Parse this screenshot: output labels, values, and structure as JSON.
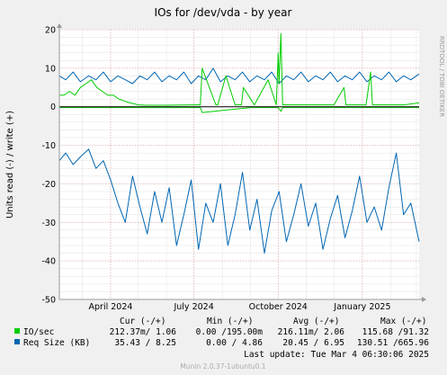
{
  "chart_data": {
    "type": "line",
    "title": "IOs for /dev/vda - by year",
    "ylabel": "Units read (-) / write (+)",
    "side_label": "RRDTOOL / TOBI OETIKER",
    "footer": "Munin 2.0.37-1ubuntu0.1",
    "last_update": "Last update: Tue Mar  4 06:30:06 2025",
    "ylim": [
      -50,
      20
    ],
    "y_ticks": [
      20,
      10,
      0,
      -10,
      -20,
      -30,
      -40,
      -50
    ],
    "x_range": [
      "2024-02-05",
      "2025-03-04"
    ],
    "x_ticks": [
      {
        "date": "2024-04-01",
        "label": "April 2024"
      },
      {
        "date": "2024-07-01",
        "label": "July 2024"
      },
      {
        "date": "2024-10-01",
        "label": "October 2024"
      },
      {
        "date": "2025-01-01",
        "label": "January 2025"
      }
    ],
    "grid": true,
    "legend_headers": [
      "Cur (-/+)",
      "Min (-/+)",
      "Avg (-/+)",
      "Max (-/+)"
    ],
    "series": [
      {
        "name": "IO/sec",
        "color": "#00cc00",
        "cur": "212.37m/ 1.06",
        "min": "0.00 /195.00m",
        "avg": "216.11m/ 2.06",
        "max": "115.68 /91.32",
        "write_x": [
          "2024-02-05",
          "2024-02-10",
          "2024-02-16",
          "2024-02-22",
          "2024-02-28",
          "2024-03-05",
          "2024-03-11",
          "2024-03-17",
          "2024-03-23",
          "2024-03-29",
          "2024-04-04",
          "2024-04-10",
          "2024-04-16",
          "2024-04-22",
          "2024-04-28",
          "2024-05-01",
          "2024-05-10",
          "2024-06-01",
          "2024-07-01",
          "2024-07-08",
          "2024-07-10",
          "2024-07-25",
          "2024-07-27",
          "2024-08-05",
          "2024-08-15",
          "2024-08-22",
          "2024-08-24",
          "2024-09-05",
          "2024-09-20",
          "2024-09-29",
          "2024-10-01",
          "2024-10-02",
          "2024-10-04",
          "2024-10-06",
          "2024-10-15",
          "2024-11-05",
          "2024-12-01",
          "2024-12-12",
          "2024-12-14",
          "2025-01-05",
          "2025-01-10",
          "2025-01-12",
          "2025-02-01",
          "2025-02-15",
          "2025-03-04"
        ],
        "write_y": [
          3,
          3,
          4,
          3,
          5,
          6,
          7,
          5,
          4,
          3,
          3,
          2,
          1.5,
          1,
          0.7,
          0.5,
          0.4,
          0.4,
          0.5,
          0.5,
          10,
          0.5,
          0.5,
          8,
          0.5,
          0.5,
          5,
          0.5,
          7,
          0.5,
          14,
          6,
          19,
          0.5,
          0.5,
          0.5,
          0.5,
          5,
          0.5,
          0.5,
          9,
          0.5,
          0.5,
          0.5,
          1
        ],
        "read_x": [
          "2024-02-05",
          "2024-05-01",
          "2024-07-01",
          "2024-07-08",
          "2024-07-10",
          "2024-09-01",
          "2024-10-01",
          "2024-10-04",
          "2024-10-06",
          "2025-03-04"
        ],
        "read_y": [
          -0.2,
          -0.2,
          -0.2,
          -0.2,
          -1.5,
          -0.2,
          -0.2,
          -1.2,
          -0.2,
          -0.2
        ]
      },
      {
        "name": "Req Size (KB)",
        "color": "#0066b3",
        "cur": "35.43 / 8.25",
        "min": "0.00 / 4.86",
        "avg": "20.45 / 6.95",
        "max": "130.51 /665.96",
        "write_x": [
          "2024-02-05",
          "2024-02-12",
          "2024-02-20",
          "2024-02-28",
          "2024-03-08",
          "2024-03-16",
          "2024-03-24",
          "2024-04-01",
          "2024-04-09",
          "2024-04-17",
          "2024-04-25",
          "2024-05-03",
          "2024-05-11",
          "2024-05-19",
          "2024-05-27",
          "2024-06-04",
          "2024-06-12",
          "2024-06-20",
          "2024-06-28",
          "2024-07-06",
          "2024-07-14",
          "2024-07-22",
          "2024-07-30",
          "2024-08-07",
          "2024-08-15",
          "2024-08-23",
          "2024-08-31",
          "2024-09-08",
          "2024-09-16",
          "2024-09-24",
          "2024-10-02",
          "2024-10-10",
          "2024-10-18",
          "2024-10-26",
          "2024-11-03",
          "2024-11-11",
          "2024-11-19",
          "2024-11-27",
          "2024-12-05",
          "2024-12-13",
          "2024-12-21",
          "2024-12-29",
          "2025-01-06",
          "2025-01-14",
          "2025-01-22",
          "2025-01-30",
          "2025-02-07",
          "2025-02-15",
          "2025-02-23",
          "2025-03-04"
        ],
        "write_y": [
          8,
          7,
          9,
          6.5,
          8,
          7,
          9,
          6.5,
          8,
          7,
          6,
          8,
          7,
          9,
          6.5,
          8,
          7,
          9,
          6,
          8,
          7,
          10,
          6.5,
          8,
          7,
          9,
          6.5,
          8,
          7,
          9,
          6,
          8,
          7,
          9,
          6.5,
          8,
          7,
          9,
          6.5,
          8,
          7,
          9,
          6.5,
          8,
          7,
          9,
          6.5,
          8,
          7,
          8.5
        ],
        "read_x": [
          "2024-02-05",
          "2024-02-12",
          "2024-02-20",
          "2024-02-28",
          "2024-03-08",
          "2024-03-16",
          "2024-03-24",
          "2024-04-01",
          "2024-04-09",
          "2024-04-17",
          "2024-04-25",
          "2024-05-03",
          "2024-05-11",
          "2024-05-19",
          "2024-05-27",
          "2024-06-04",
          "2024-06-12",
          "2024-06-20",
          "2024-06-28",
          "2024-07-06",
          "2024-07-14",
          "2024-07-22",
          "2024-07-30",
          "2024-08-07",
          "2024-08-15",
          "2024-08-23",
          "2024-08-31",
          "2024-09-08",
          "2024-09-16",
          "2024-09-24",
          "2024-10-02",
          "2024-10-10",
          "2024-10-18",
          "2024-10-26",
          "2024-11-03",
          "2024-11-11",
          "2024-11-19",
          "2024-11-27",
          "2024-12-05",
          "2024-12-13",
          "2024-12-21",
          "2024-12-29",
          "2025-01-06",
          "2025-01-14",
          "2025-01-22",
          "2025-01-30",
          "2025-02-07",
          "2025-02-15",
          "2025-02-23",
          "2025-03-04"
        ],
        "read_y": [
          -14,
          -12,
          -15,
          -13,
          -11,
          -16,
          -14,
          -19,
          -25,
          -30,
          -18,
          -26,
          -33,
          -22,
          -30,
          -21,
          -36,
          -28,
          -19,
          -37,
          -25,
          -30,
          -20,
          -36,
          -28,
          -17,
          -32,
          -24,
          -38,
          -27,
          -22,
          -35,
          -28,
          -20,
          -31,
          -25,
          -37,
          -29,
          -23,
          -34,
          -27,
          -18,
          -30,
          -26,
          -32,
          -21,
          -12,
          -28,
          -25,
          -35
        ]
      }
    ]
  }
}
